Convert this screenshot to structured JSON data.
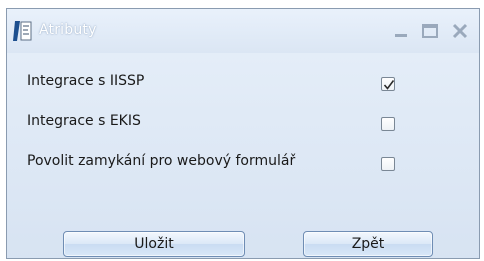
{
  "window": {
    "title": "Atributy"
  },
  "options": [
    {
      "label": "Integrace s IISSP",
      "checked": true
    },
    {
      "label": "Integrace s EKIS",
      "checked": false
    },
    {
      "label": "Povolit zamykání pro webový formulář",
      "checked": false
    }
  ],
  "buttons": {
    "save_label": "Uložit",
    "back_label": "Zpět"
  },
  "icons": {
    "app": "app-document-icon",
    "minimize": "minimize-icon",
    "maximize": "maximize-icon",
    "close": "close-icon",
    "check": "checkmark-icon"
  },
  "colors": {
    "accent": "#6f8db4",
    "window_bg": "#dde8f5"
  }
}
